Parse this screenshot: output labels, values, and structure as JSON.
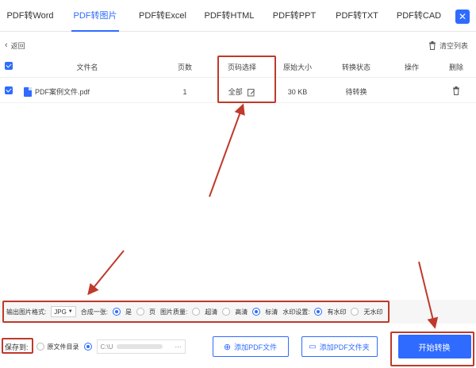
{
  "tabs": [
    {
      "label": "PDF转Word"
    },
    {
      "label": "PDF转图片"
    },
    {
      "label": "PDF转Excel"
    },
    {
      "label": "PDF转HTML"
    },
    {
      "label": "PDF转PPT"
    },
    {
      "label": "PDF转TXT"
    },
    {
      "label": "PDF转CAD"
    }
  ],
  "toolbar": {
    "back_label": "返回",
    "clear_label": "清空列表"
  },
  "table": {
    "headers": [
      "文件名",
      "页数",
      "页码选择",
      "原始大小",
      "转换状态",
      "操作",
      "删除"
    ],
    "rows": [
      {
        "name": "PDF案例文件.pdf",
        "pages": "1",
        "page_select": "全部",
        "size": "30 KB",
        "status": "待转换"
      }
    ]
  },
  "options": {
    "format_label": "输出图片格式:",
    "format_value": "JPG",
    "merge_label": "合成一张:",
    "merge_yes": "是",
    "merge_no": "页",
    "quality_label": "图片质量:",
    "quality_options": [
      "超清",
      "高清",
      "标清"
    ],
    "watermark_label": "水印设置:",
    "watermark_options": [
      "有水印",
      "无水印"
    ]
  },
  "bottom": {
    "save_to_label": "保存到:",
    "source_dir_label": "原文件目录",
    "path_value": "C:\\U",
    "add_pdf_label": "添加PDF文件",
    "add_folder_label": "添加PDF文件夹",
    "start_label": "开始转换"
  },
  "colors": {
    "accent": "#2f6bff",
    "annotation": "#c0392b"
  }
}
